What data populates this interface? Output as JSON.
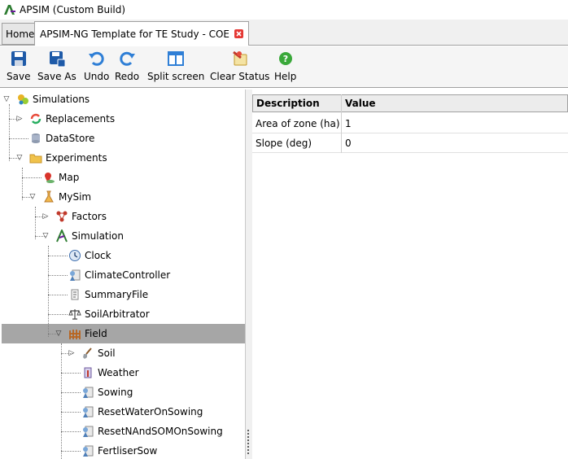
{
  "window": {
    "title": "APSIM (Custom Build)"
  },
  "tabs": {
    "home": "Home",
    "document": "APSIM-NG Template for TE Study - COE"
  },
  "toolbar": {
    "save": "Save",
    "save_as": "Save As",
    "undo": "Undo",
    "redo": "Redo",
    "split_screen": "Split screen",
    "clear_status": "Clear Status",
    "help": "Help"
  },
  "tree": {
    "simulations": "Simulations",
    "replacements": "Replacements",
    "datastore": "DataStore",
    "experiments": "Experiments",
    "map": "Map",
    "mysim": "MySim",
    "factors": "Factors",
    "simulation": "Simulation",
    "clock": "Clock",
    "climate_controller": "ClimateController",
    "summary_file": "SummaryFile",
    "soil_arbitrator": "SoilArbitrator",
    "field": "Field",
    "soil": "Soil",
    "weather": "Weather",
    "sowing": "Sowing",
    "reset_water": "ResetWaterOnSowing",
    "reset_n_som": "ResetNAndSOMOnSowing",
    "fertiliser_sow": "FertliserSow"
  },
  "grid": {
    "headers": {
      "description": "Description",
      "value": "Value"
    },
    "rows": [
      {
        "description": "Area of zone (ha)",
        "value": "1"
      },
      {
        "description": "Slope (deg)",
        "value": "0"
      }
    ]
  }
}
